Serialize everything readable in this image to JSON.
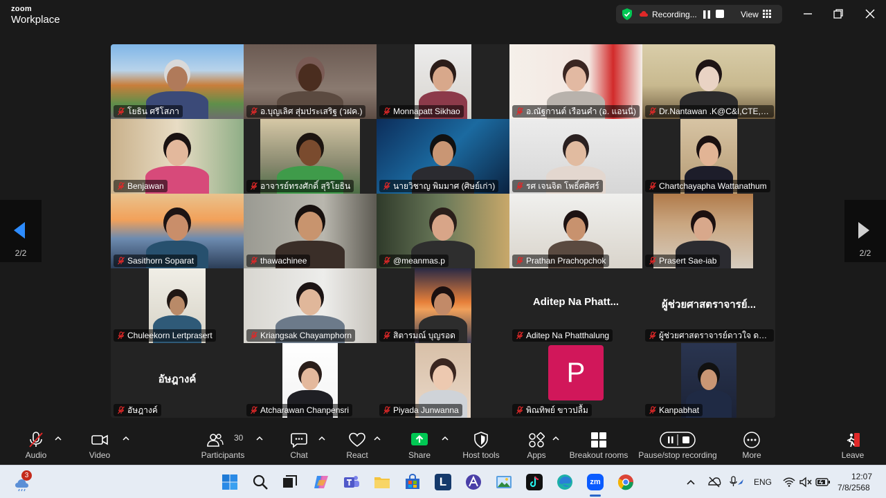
{
  "app": {
    "brand_top": "zoom",
    "brand_bottom": "Workplace"
  },
  "header": {
    "recording_label": "Recording...",
    "view_label": "View"
  },
  "pagination": {
    "left": "2/2",
    "right": "2/2"
  },
  "participants": [
    {
      "name": "โยธิน ศรีโสภา",
      "display": "video"
    },
    {
      "name": "อ.บุญเลิศ สุ่มประเสริฐ (วฝค.)",
      "display": "video"
    },
    {
      "name": "Monnapatt Sikhao",
      "display": "video"
    },
    {
      "name": "อ.ณัฐกานต์ เรือนคำ (อ. แอนนี่)",
      "display": "video"
    },
    {
      "name": "Dr.Nantawan .K@C&I,CTE,P...",
      "display": "video"
    },
    {
      "name": "Benjawan",
      "display": "video"
    },
    {
      "name": "อาจารย์ทรงศักดิ์ สุริโยธิน",
      "display": "video"
    },
    {
      "name": "นายวิชาญ พิมมาศ (ศิษย์เก่า)",
      "display": "video"
    },
    {
      "name": "รศ เจนจิต โพธิ์ศศิศร์",
      "display": "video"
    },
    {
      "name": "Chartchayapha Wattanathum",
      "display": "video"
    },
    {
      "name": "Sasithorn Soparat",
      "display": "video"
    },
    {
      "name": "thawachinee",
      "display": "video"
    },
    {
      "name": "@meanmas.p",
      "display": "video"
    },
    {
      "name": "Prathan Prachopchok",
      "display": "video"
    },
    {
      "name": "Prasert Sae-iab",
      "display": "video"
    },
    {
      "name": "Chuleekorn Lertprasert",
      "display": "video"
    },
    {
      "name": "Kriangsak Chayamphorn",
      "display": "video"
    },
    {
      "name": "สิตารมณ์ บุญรอด",
      "display": "video"
    },
    {
      "name": "Aditep Na Phatthalung",
      "display": "name",
      "big": "Aditep Na Phatt..."
    },
    {
      "name": "ผู้ช่วยศาสตราจารย์ดาวใจ  ดวงมณี",
      "display": "name",
      "big": "ผู้ช่วยศาสตราจารย์..."
    },
    {
      "name": "อัษฎางค์",
      "display": "name",
      "big": "อัษฎางค์"
    },
    {
      "name": "Atcharawan Chanpensri",
      "display": "video"
    },
    {
      "name": "Piyada Junwanna",
      "display": "video"
    },
    {
      "name": "พิณทิพย์ ขาวปลื้ม",
      "display": "avatar",
      "initial": "P"
    },
    {
      "name": "Kanpabhat",
      "display": "video"
    }
  ],
  "toolbar": {
    "audio": "Audio",
    "video": "Video",
    "participants": "Participants",
    "participants_count": "30",
    "chat": "Chat",
    "react": "React",
    "share": "Share",
    "host_tools": "Host tools",
    "apps": "Apps",
    "breakout": "Breakout rooms",
    "pause_stop": "Pause/stop recording",
    "more": "More",
    "leave": "Leave"
  },
  "taskbar": {
    "weather_badge": "3",
    "language": "ENG",
    "time": "12:07",
    "date": "7/8/2568",
    "letter_app": "L"
  },
  "colors": {
    "accent_green": "#00c853",
    "recording_red": "#e02828",
    "avatar_pink": "#d1175a",
    "nav_blue": "#2d8cff",
    "leave_red": "#e02828"
  }
}
